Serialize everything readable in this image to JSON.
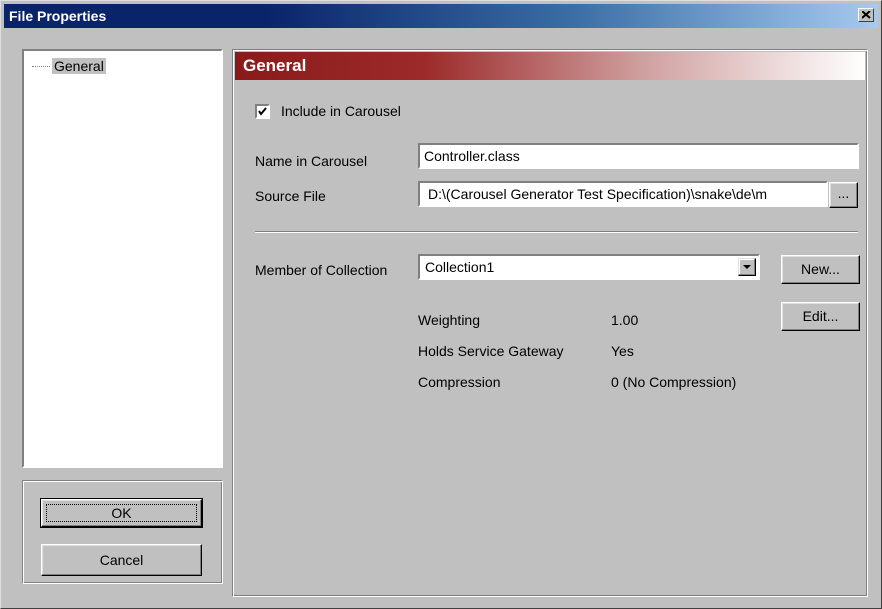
{
  "window": {
    "title": "File Properties"
  },
  "tree": {
    "items": [
      {
        "label": "General"
      }
    ]
  },
  "buttons": {
    "ok": "OK",
    "cancel": "Cancel"
  },
  "panel": {
    "header": "General",
    "include_in_carousel": {
      "label": "Include in Carousel",
      "checked": true
    },
    "name_in_carousel": {
      "label": "Name in Carousel",
      "value": "Controller.class"
    },
    "source_file": {
      "label": "Source File",
      "value": "D:\\(Carousel Generator Test Specification)\\snake\\de\\m",
      "browse": "..."
    },
    "member_of_collection": {
      "label": "Member of Collection",
      "value": "Collection1",
      "new_button": "New...",
      "edit_button": "Edit..."
    },
    "details": [
      {
        "label": "Weighting",
        "value": "1.00"
      },
      {
        "label": "Holds Service Gateway",
        "value": "Yes"
      },
      {
        "label": "Compression",
        "value": "0 (No Compression)"
      }
    ]
  },
  "colors": {
    "title_bar": "#0a246a",
    "panel_header": "#8b1a1a",
    "face": "#c0c0c0"
  },
  "icons": {
    "close": "close-icon",
    "check": "checkmark-icon",
    "dropdown": "chevron-down-icon"
  }
}
